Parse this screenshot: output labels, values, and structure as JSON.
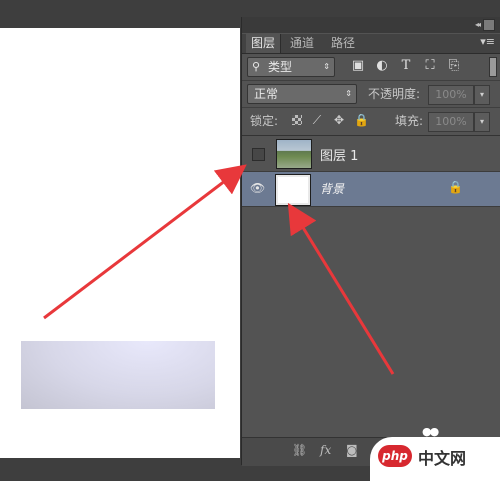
{
  "panel": {
    "tabs": [
      "图层",
      "通道",
      "路径"
    ],
    "filter": {
      "value": "类型",
      "icons": [
        "image-icon",
        "circle-half-icon",
        "type-icon",
        "transform-icon",
        "smart-object-icon"
      ]
    },
    "blend": {
      "value": "正常",
      "opacity_label": "不透明度:",
      "opacity_value": "100%"
    },
    "lock": {
      "label": "锁定:",
      "fill_label": "填充:",
      "fill_value": "100%"
    },
    "layers": [
      {
        "name": "图层 1",
        "visible": false,
        "selected": false
      },
      {
        "name": "背景",
        "visible": true,
        "selected": true,
        "locked": true
      }
    ],
    "footer_icons": [
      "link-icon",
      "fx-icon",
      "mask-icon"
    ]
  },
  "watermark": {
    "logo": "php",
    "text": "中文网"
  },
  "colors": {
    "panel_bg": "#535353",
    "selected_layer": "#6c7a92",
    "arrow": "#e8383b"
  }
}
